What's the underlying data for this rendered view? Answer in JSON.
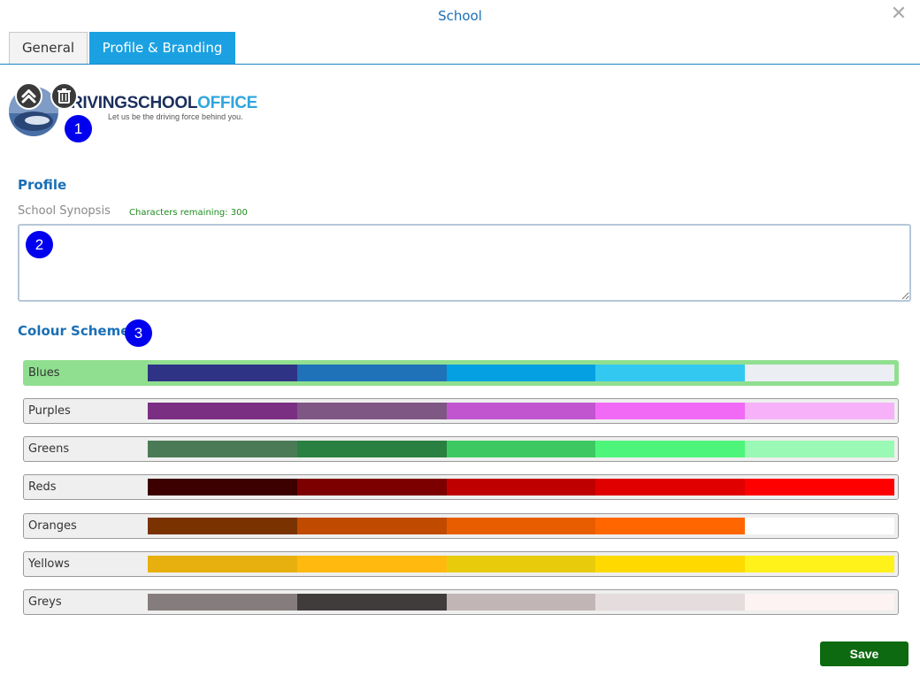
{
  "dialog": {
    "title": "School",
    "close_icon": "close-icon"
  },
  "tabs": [
    {
      "label": "General",
      "active": false
    },
    {
      "label": "Profile & Branding",
      "active": true
    }
  ],
  "logo": {
    "brand_dark": "RIVINGSCHOOL",
    "brand_light": "OFFICE",
    "tagline": "Let us be the driving force behind you.",
    "actions": [
      {
        "icon": "chevron-up-icon"
      },
      {
        "icon": "trash-icon"
      }
    ]
  },
  "badges": [
    "1",
    "2",
    "3"
  ],
  "profile": {
    "section_title": "Profile",
    "synopsis_label": "School Synopsis",
    "chars_remaining": "Characters remaining: 300",
    "synopsis_value": ""
  },
  "colour_schemes": {
    "section_title": "Colour Schemes",
    "selected": "Blues",
    "items": [
      {
        "name": "Blues",
        "colors": [
          "#2e3386",
          "#1f72b8",
          "#05a0e1",
          "#33c8f0",
          "#ebeef3"
        ]
      },
      {
        "name": "Purples",
        "colors": [
          "#7b2f82",
          "#7f5785",
          "#c055cf",
          "#f16af5",
          "#f6b1f9"
        ]
      },
      {
        "name": "Greens",
        "colors": [
          "#4b7a56",
          "#2a8040",
          "#3ec862",
          "#4ef57b",
          "#9af9b4"
        ]
      },
      {
        "name": "Reds",
        "colors": [
          "#3c0000",
          "#7d0000",
          "#bf0000",
          "#e00000",
          "#ff0000"
        ]
      },
      {
        "name": "Oranges",
        "colors": [
          "#7a3300",
          "#c04b00",
          "#e85d00",
          "#ff6600",
          "#ffffff"
        ]
      },
      {
        "name": "Yellows",
        "colors": [
          "#e8b00e",
          "#ffb90f",
          "#e8cc0c",
          "#ffd900",
          "#fff11a"
        ]
      },
      {
        "name": "Greys",
        "colors": [
          "#857d7d",
          "#403c3c",
          "#c1b5b5",
          "#e5dddd",
          "#fdf3f3"
        ]
      }
    ]
  },
  "footer": {
    "save_label": "Save",
    "save_color": "#0d6a10"
  }
}
